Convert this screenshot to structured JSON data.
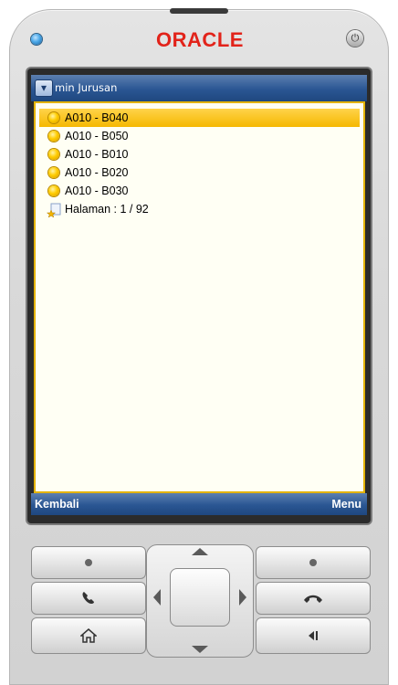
{
  "device": {
    "brand": "ORACLE",
    "icons": {
      "led": "status-led-icon",
      "power": "power-icon"
    }
  },
  "screen": {
    "title": "min Jurusan",
    "title_dropdown_icon": "chevron-down-icon",
    "items": [
      {
        "label": "A010 - B040",
        "selected": true,
        "icon": "yellow-dot-icon"
      },
      {
        "label": "A010 - B050",
        "selected": false,
        "icon": "yellow-dot-icon"
      },
      {
        "label": "A010 - B010",
        "selected": false,
        "icon": "yellow-dot-icon"
      },
      {
        "label": "A010 - B020",
        "selected": false,
        "icon": "yellow-dot-icon"
      },
      {
        "label": "A010 - B030",
        "selected": false,
        "icon": "yellow-dot-icon"
      }
    ],
    "pagination": {
      "label": "Halaman : 1 / 92",
      "icon": "page-star-icon"
    },
    "softkeys": {
      "left": "Kembali",
      "right": "Menu"
    }
  },
  "keypad": {
    "icons": [
      "left-soft-key-icon",
      "right-soft-key-icon",
      "call-icon",
      "end-call-icon",
      "home-icon",
      "back-icon",
      "dpad-up-icon",
      "dpad-down-icon",
      "dpad-left-icon",
      "dpad-right-icon",
      "dpad-select-icon"
    ]
  },
  "colors": {
    "brand_red": "#e2231a",
    "title_bar_blue": "#2a5693",
    "selection_yellow": "#f5b800",
    "content_background": "#fffff4"
  }
}
